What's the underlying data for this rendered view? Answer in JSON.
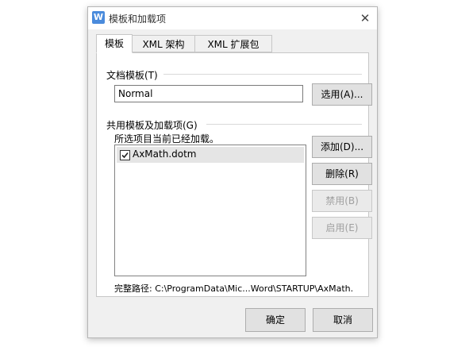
{
  "window": {
    "title": "模板和加载项",
    "app_icon_letter": "W",
    "close_glyph": "✕"
  },
  "tabs": [
    {
      "label": "模板"
    },
    {
      "label": "XML 架构"
    },
    {
      "label": "XML 扩展包"
    }
  ],
  "document_template": {
    "group_title": "文档模板(T)",
    "value": "Normal",
    "choose_label": "选用(A)..."
  },
  "global_templates": {
    "group_title": "共用模板及加载项(G)",
    "note": "所选项目当前已经加载。",
    "items": [
      {
        "label": "AxMath.dotm",
        "checked": true
      }
    ],
    "buttons": {
      "add": "添加(D)...",
      "remove": "删除(R)",
      "disable": "禁用(B)",
      "enable": "启用(E)"
    },
    "full_path_label": "完整路径:",
    "full_path_value": "C:\\ProgramData\\Mic...Word\\STARTUP\\AxMath."
  },
  "footer": {
    "ok": "确定",
    "cancel": "取消"
  },
  "colors": {
    "dialog_bg": "#f0f0f0",
    "panel_bg": "#ffffff",
    "selection_bg": "#e5e5e5",
    "app_icon": "#4a8bdc"
  }
}
